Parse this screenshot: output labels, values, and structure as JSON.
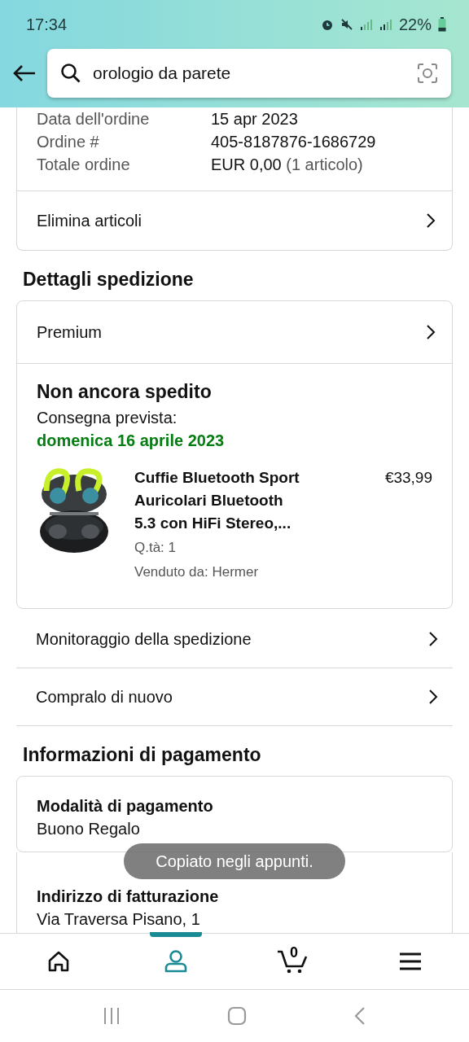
{
  "status_bar": {
    "time": "17:34",
    "battery": "22%"
  },
  "search": {
    "value": "orologio da parete"
  },
  "order_summary": {
    "rows": [
      {
        "label": "Data dell'ordine",
        "value": "15 apr 2023"
      },
      {
        "label": "Ordine #",
        "value": "405-8187876-1686729"
      },
      {
        "label": "Totale ordine",
        "value": "EUR 0,00",
        "note": "(1 articolo)"
      }
    ],
    "link": "Elimina articoli"
  },
  "shipping": {
    "title": "Dettagli spedizione",
    "service": "Premium",
    "status": "Non ancora spedito",
    "delivery_label": "Consegna prevista:",
    "delivery_date": "domenica 16 aprile 2023",
    "item": {
      "title": "Cuffie Bluetooth Sport Auricolari Bluetooth 5.3 con HiFi Stereo,...",
      "price": "€33,99",
      "quantity": "Q.tà: 1",
      "seller": "Venduto da: Hermer"
    },
    "links": [
      "Monitoraggio della spedizione",
      "Compralo di nuovo"
    ]
  },
  "payment": {
    "title": "Informazioni di pagamento",
    "method_label": "Modalità di pagamento",
    "method": "Buono Regalo",
    "billing_label": "Indirizzo di fatturazione",
    "billing": "Via Traversa Pisano, 1"
  },
  "toast": "Copiato negli appunti.",
  "bottom_nav": [
    {
      "kind": "home",
      "selected": false
    },
    {
      "kind": "account",
      "selected": true
    },
    {
      "kind": "cart",
      "selected": false,
      "count": "0"
    },
    {
      "kind": "menu",
      "selected": false
    }
  ]
}
